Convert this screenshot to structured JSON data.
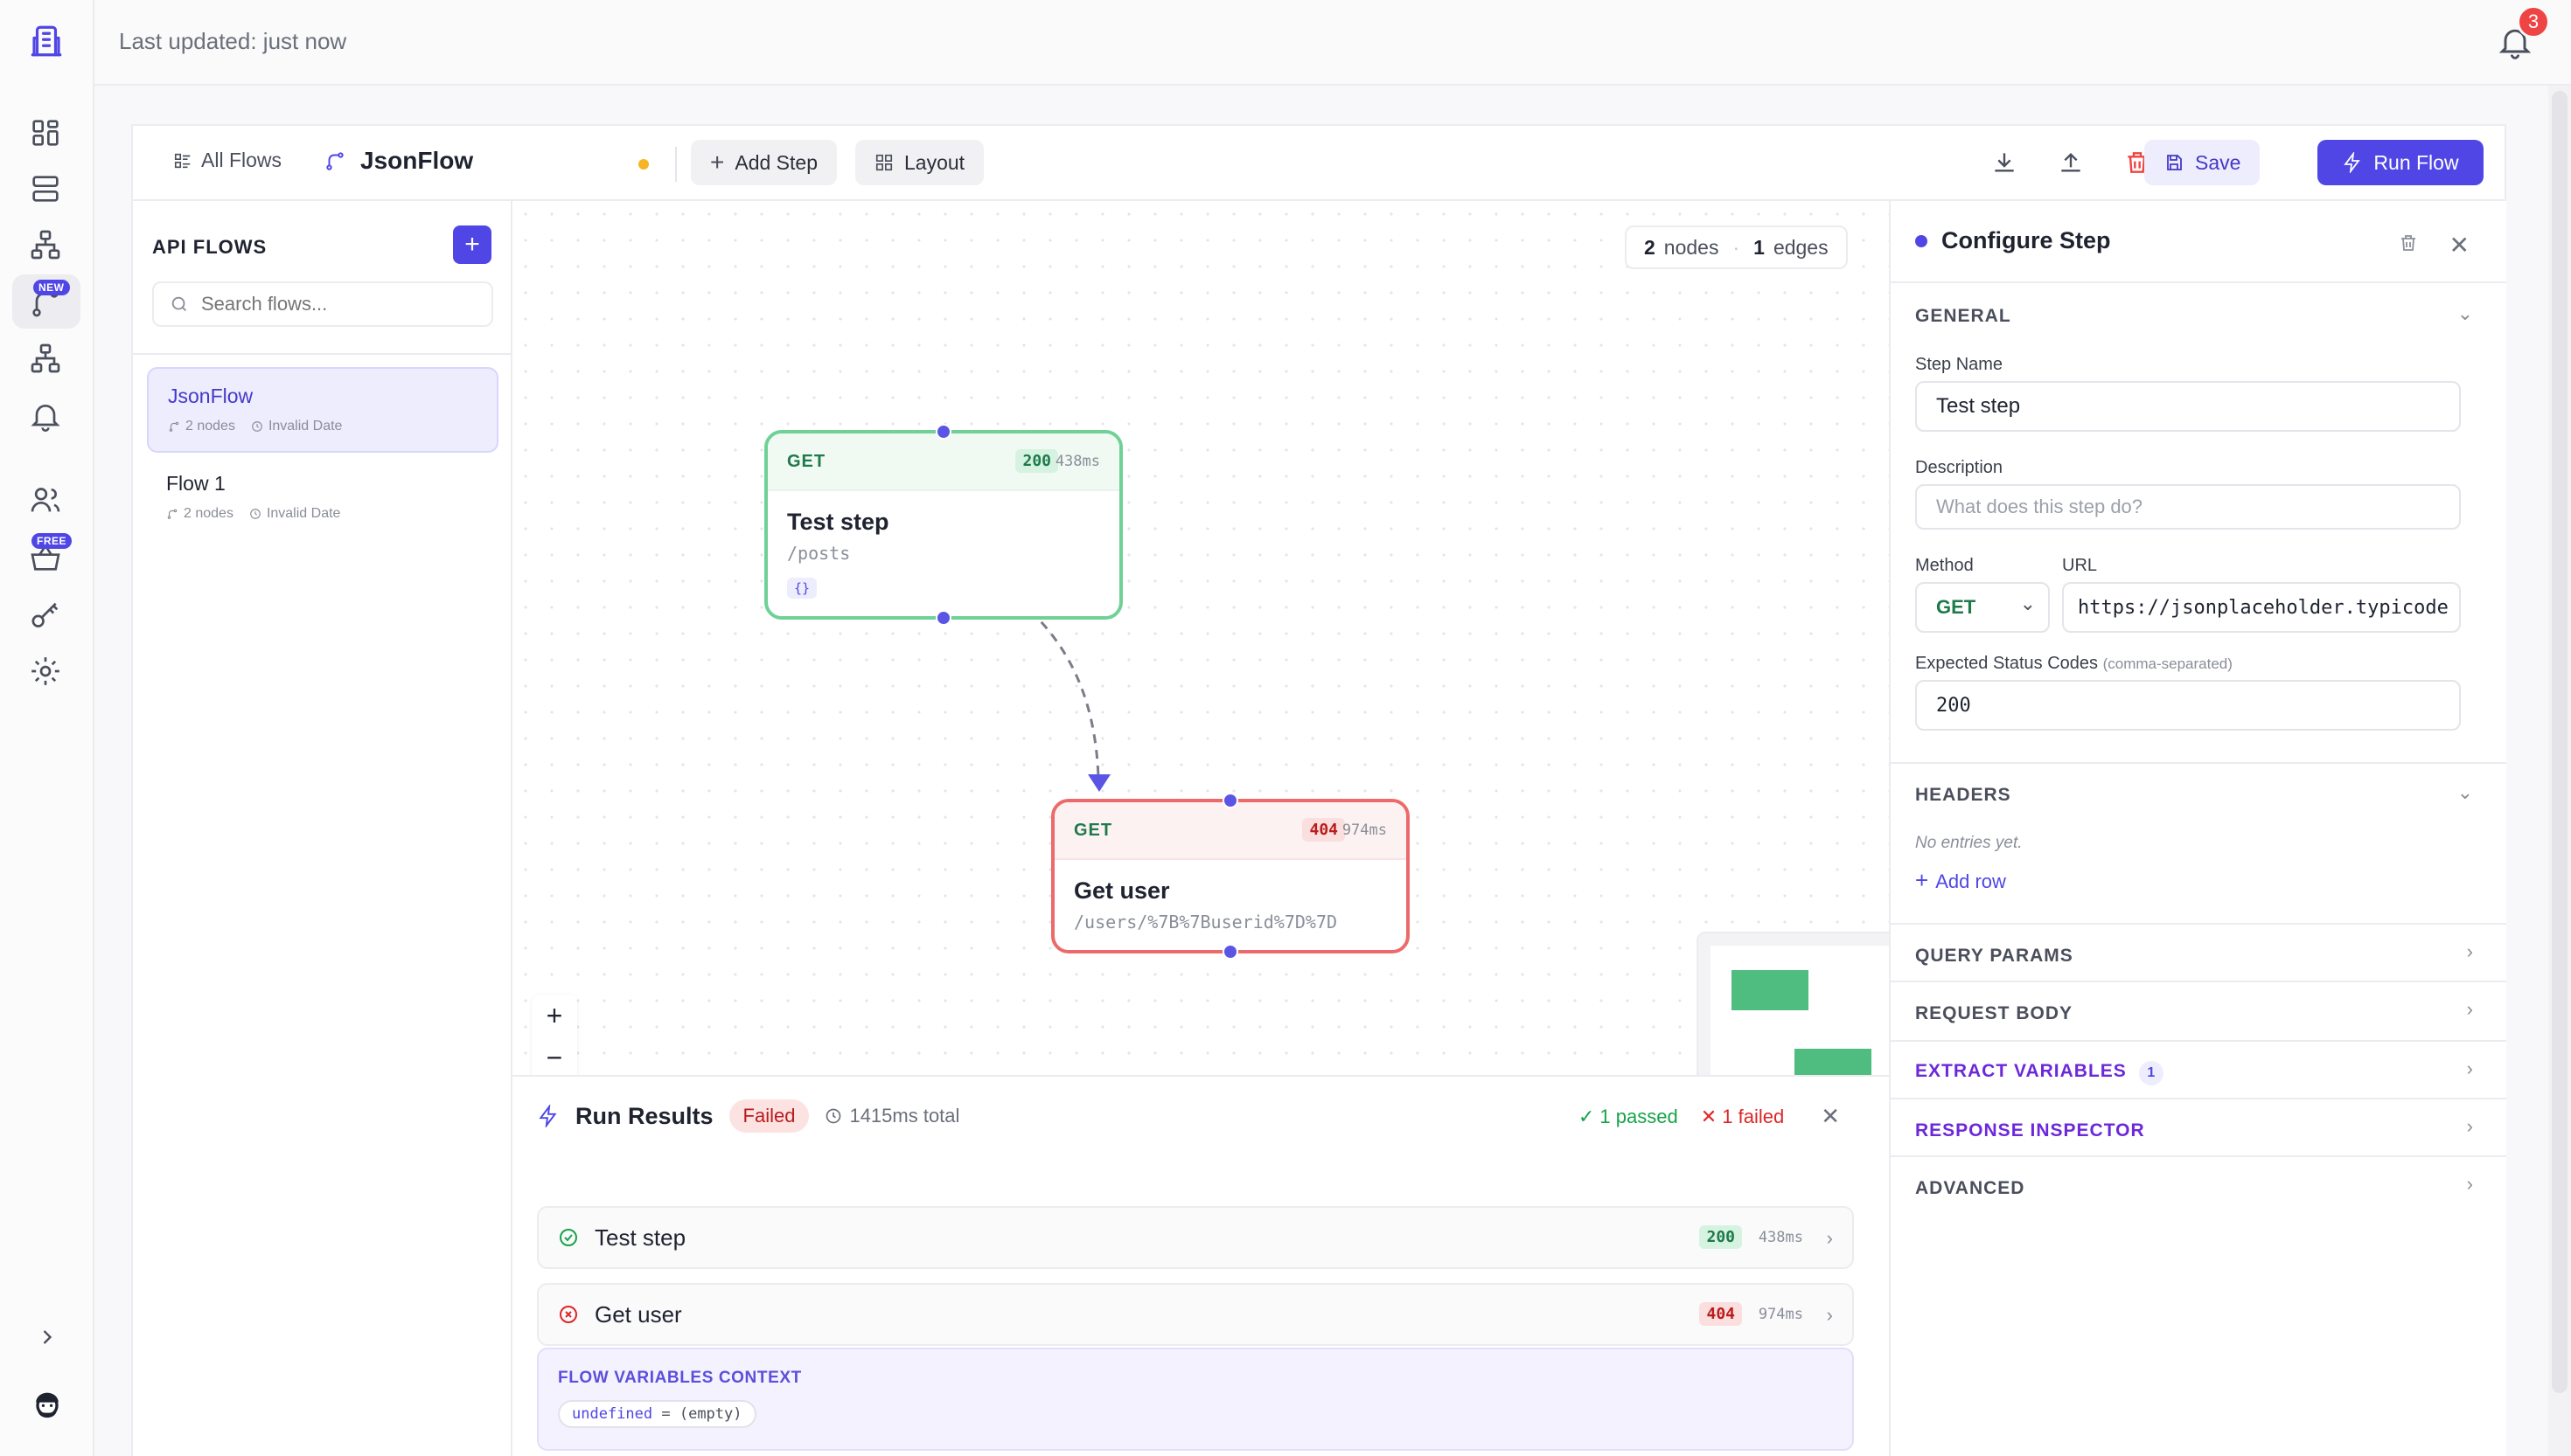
{
  "topbar": {
    "updated": "Last updated: just now",
    "notifications": "3"
  },
  "rail": {
    "tag_new": "NEW",
    "tag_free": "FREE"
  },
  "toolbar": {
    "all_flows": "All Flows",
    "flow_name": "JsonFlow",
    "add_step": "Add Step",
    "layout": "Layout",
    "save": "Save",
    "run_flow": "Run Flow"
  },
  "sidebar": {
    "title": "API FLOWS",
    "add": "+",
    "search_placeholder": "Search flows...",
    "flows": [
      {
        "name": "JsonFlow",
        "nodes": "2 nodes",
        "date": "Invalid Date"
      },
      {
        "name": "Flow 1",
        "nodes": "2 nodes",
        "date": "Invalid Date"
      }
    ]
  },
  "canvas": {
    "node_count": "2",
    "nodes_label": "nodes",
    "edge_count": "1",
    "edges_label": "edges",
    "nodes": [
      {
        "method": "GET",
        "status": "200",
        "time": "438ms",
        "title": "Test step",
        "path": "/posts",
        "badge": "{}"
      },
      {
        "method": "GET",
        "status": "404",
        "time": "974ms",
        "title": "Get user",
        "path": "/users/%7B%7Buserid%7D%7D"
      }
    ],
    "zoom": {
      "in": "+",
      "out": "−"
    }
  },
  "results": {
    "title": "Run Results",
    "status": "Failed",
    "total": "1415ms total",
    "passed": "✓ 1 passed",
    "failed": "✕ 1 failed",
    "rows": [
      {
        "name": "Test step",
        "status": "200",
        "time": "438ms"
      },
      {
        "name": "Get user",
        "status": "404",
        "time": "974ms"
      }
    ],
    "vars_title": "FLOW VARIABLES CONTEXT",
    "var_key": "undefined",
    "var_eq": " = ",
    "var_val": "(empty)"
  },
  "config": {
    "title": "Configure Step",
    "general": "GENERAL",
    "step_name_label": "Step Name",
    "step_name": "Test step",
    "description_label": "Description",
    "description_placeholder": "What does this step do?",
    "method_label": "Method",
    "method": "GET",
    "url_label": "URL",
    "url": "https://jsonplaceholder.typicode",
    "status_codes_label": "Expected Status Codes",
    "status_codes_hint": "(comma-separated)",
    "status_codes": "200",
    "headers": "HEADERS",
    "no_entries": "No entries yet.",
    "add_row": "Add row",
    "query_params": "QUERY PARAMS",
    "request_body": "REQUEST BODY",
    "extract_variables": "EXTRACT VARIABLES",
    "extract_count": "1",
    "response_inspector": "RESPONSE INSPECTOR",
    "advanced": "ADVANCED"
  }
}
